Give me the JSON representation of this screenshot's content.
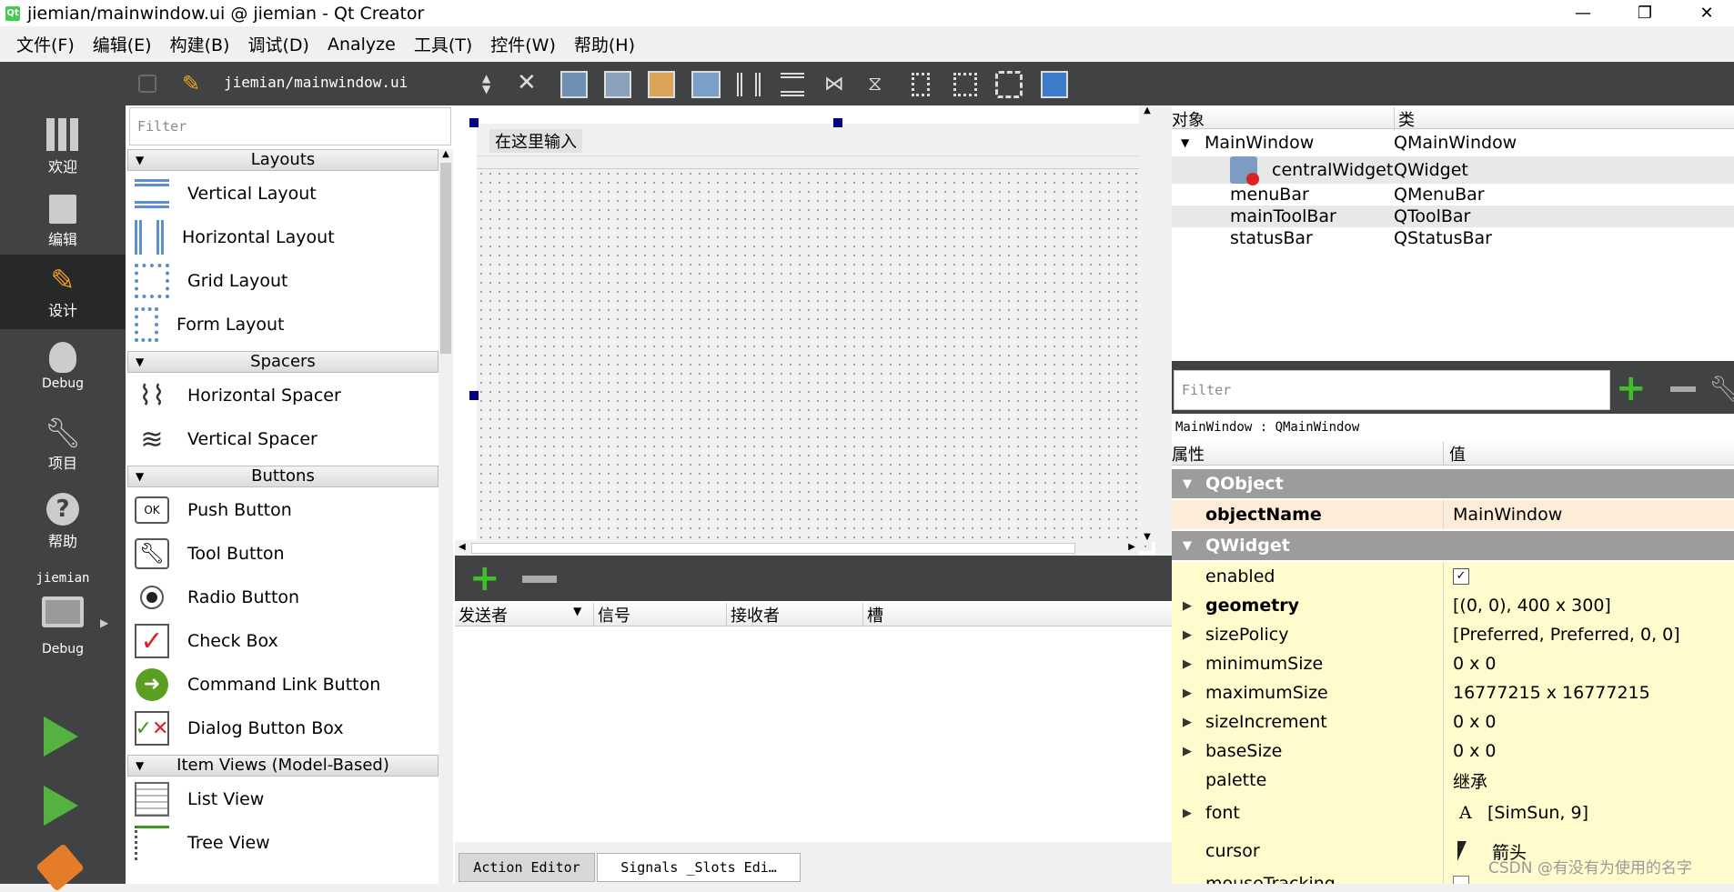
{
  "window": {
    "title": "jiemian/mainwindow.ui @ jiemian - Qt Creator",
    "minimize": "—",
    "restore": "❐",
    "close": "✕"
  },
  "menu": [
    "文件(F)",
    "编辑(E)",
    "构建(B)",
    "调试(D)",
    "Analyze",
    "工具(T)",
    "控件(W)",
    "帮助(H)"
  ],
  "toolbar": {
    "file": "jiemian/mainwindow.ui"
  },
  "modes": [
    {
      "label": "欢迎",
      "icon": "grid-icon"
    },
    {
      "label": "编辑",
      "icon": "document-icon"
    },
    {
      "label": "设计",
      "icon": "pencil-icon"
    },
    {
      "label": "Debug",
      "icon": "bug-icon"
    },
    {
      "label": "项目",
      "icon": "wrench-icon"
    },
    {
      "label": "帮助",
      "icon": "help-icon"
    }
  ],
  "kit": {
    "project": "jiemian",
    "config": "Debug"
  },
  "widgetbox": {
    "filter_placeholder": "Filter",
    "layouts": {
      "title": "Layouts",
      "items": [
        "Vertical Layout",
        "Horizontal Layout",
        "Grid Layout",
        "Form Layout"
      ]
    },
    "spacers": {
      "title": "Spacers",
      "items": [
        "Horizontal Spacer",
        "Vertical Spacer"
      ]
    },
    "buttons": {
      "title": "Buttons",
      "items": [
        "Push Button",
        "Tool Button",
        "Radio Button",
        "Check Box",
        "Command Link Button",
        "Dialog Button Box"
      ]
    },
    "itemviews": {
      "title": "Item Views (Model-Based)",
      "items": [
        "List View",
        "Tree View"
      ]
    }
  },
  "form": {
    "menu_placeholder": "在这里输入"
  },
  "signals": {
    "columns": [
      "发送者",
      "信号",
      "接收者",
      "槽"
    ],
    "tabs": [
      "Action Editor",
      "Signals _Slots Edi…"
    ]
  },
  "objects": {
    "columns": [
      "对象",
      "类"
    ],
    "rows": [
      {
        "name": "MainWindow",
        "cls": "QMainWindow"
      },
      {
        "name": "centralWidget",
        "cls": "QWidget"
      },
      {
        "name": "menuBar",
        "cls": "QMenuBar"
      },
      {
        "name": "mainToolBar",
        "cls": "QToolBar"
      },
      {
        "name": "statusBar",
        "cls": "QStatusBar"
      }
    ]
  },
  "props": {
    "filter_placeholder": "Filter",
    "context": "MainWindow : QMainWindow",
    "columns": [
      "属性",
      "值"
    ],
    "groups": [
      {
        "name": "QObject"
      },
      {
        "name": "QWidget"
      }
    ],
    "rows": [
      {
        "name": "objectName",
        "value": "MainWindow"
      },
      {
        "name": "enabled",
        "value": "✓"
      },
      {
        "name": "geometry",
        "value": "[(0, 0), 400 x 300]"
      },
      {
        "name": "sizePolicy",
        "value": "[Preferred, Preferred, 0, 0]"
      },
      {
        "name": "minimumSize",
        "value": "0 x 0"
      },
      {
        "name": "maximumSize",
        "value": "16777215 x 16777215"
      },
      {
        "name": "sizeIncrement",
        "value": "0 x 0"
      },
      {
        "name": "baseSize",
        "value": "0 x 0"
      },
      {
        "name": "palette",
        "value": "继承"
      },
      {
        "name": "font",
        "value": "[SimSun, 9]",
        "glyph": "A"
      },
      {
        "name": "cursor",
        "value": "箭头"
      },
      {
        "name": "mouseTracking",
        "value": ""
      }
    ]
  },
  "watermark": "CSDN @有没有为使用的名字"
}
